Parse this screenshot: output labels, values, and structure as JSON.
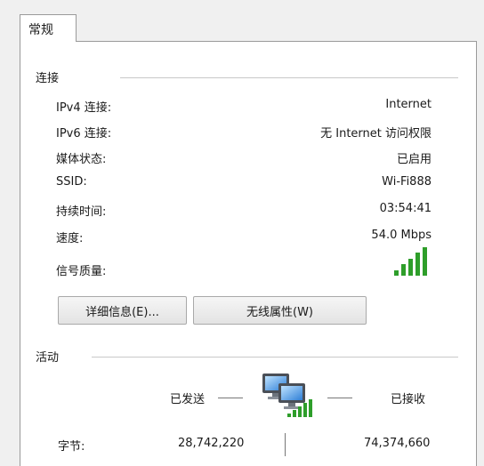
{
  "tab": {
    "label": "常规"
  },
  "connection": {
    "group_label": "连接",
    "rows": [
      {
        "label": "IPv4 连接:",
        "value": "Internet"
      },
      {
        "label": "IPv6 连接:",
        "value": "无 Internet 访问权限"
      },
      {
        "label": "媒体状态:",
        "value": "已启用"
      },
      {
        "label": "SSID:",
        "value": "Wi-Fi888"
      },
      {
        "label": "持续时间:",
        "value": "03:54:41"
      },
      {
        "label": "速度:",
        "value": "54.0 Mbps"
      },
      {
        "label": "信号质量:",
        "value": ""
      }
    ],
    "signal": {
      "bars_total": 5,
      "bars_filled": 5,
      "color": "#2e9e2a"
    }
  },
  "buttons": {
    "details": "详细信息(E)...",
    "wireless_properties": "无线属性(W)"
  },
  "activity": {
    "group_label": "活动",
    "sent_label": "已发送",
    "received_label": "已接收",
    "bytes_label": "字节:",
    "bytes_sent": "28,742,220",
    "bytes_received": "74,374,660"
  },
  "icons": {
    "network": "network-computers-icon",
    "signal": "signal-strength-icon"
  }
}
